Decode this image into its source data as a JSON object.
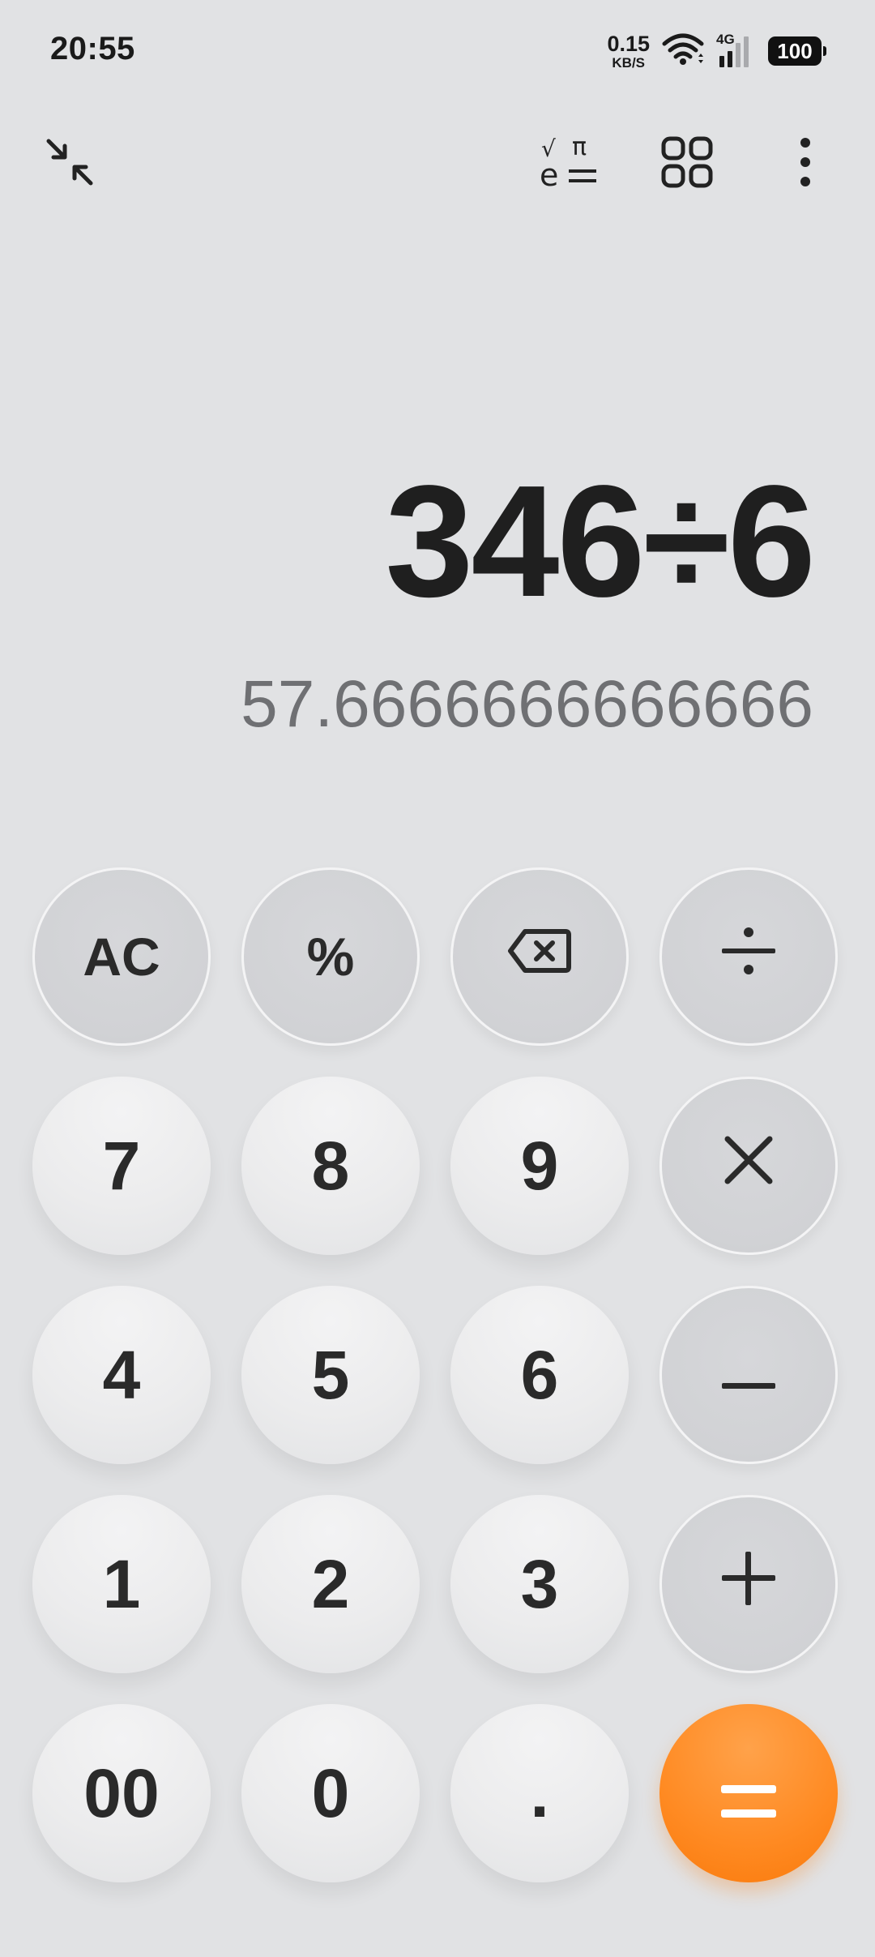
{
  "status_bar": {
    "time": "20:55",
    "net_speed_value": "0.15",
    "net_speed_unit": "KB/S",
    "network_type": "4G",
    "battery_level": "100"
  },
  "toolbar": {
    "icons": [
      "collapse-icon",
      "scientific-mode-icon",
      "unit-converter-grid-icon",
      "more-options-icon"
    ]
  },
  "display": {
    "expression": "346÷6",
    "result": "57.6666666666666"
  },
  "keypad": {
    "row1": [
      "AC",
      "%",
      "backspace",
      "÷"
    ],
    "row2": [
      "7",
      "8",
      "9",
      "×"
    ],
    "row3": [
      "4",
      "5",
      "6",
      "−"
    ],
    "row4": [
      "1",
      "2",
      "3",
      "+"
    ],
    "row5": [
      "00",
      "0",
      ".",
      "="
    ]
  },
  "colors": {
    "background": "#e1e2e4",
    "number_key": "#ececed",
    "operator_key": "#d1d2d5",
    "equals_key": "#ff8a22",
    "result_text": "#6f7073"
  }
}
